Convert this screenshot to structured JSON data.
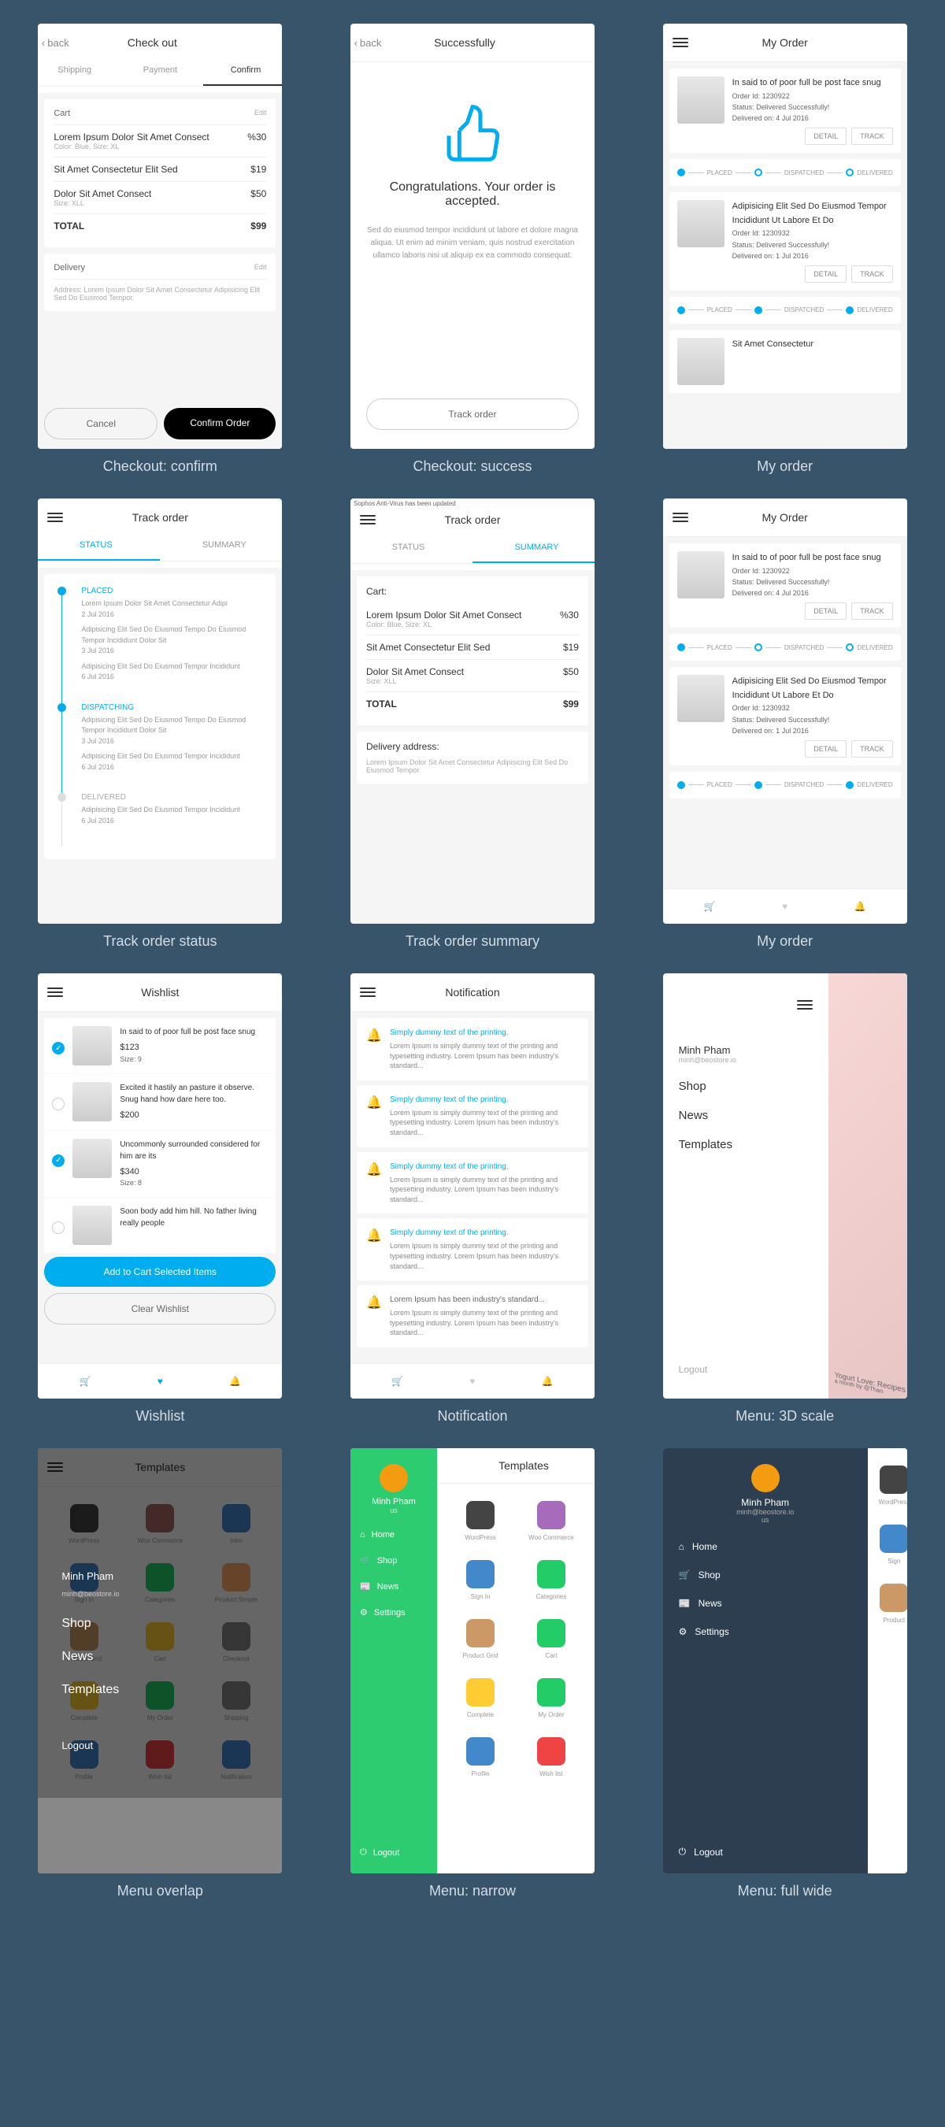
{
  "captions": {
    "checkout_confirm": "Checkout: confirm",
    "checkout_success": "Checkout: success",
    "my_order": "My order",
    "track_status": "Track order status",
    "track_summary": "Track order summary",
    "wishlist": "Wishlist",
    "notification": "Notification",
    "menu_3d": "Menu: 3D scale",
    "menu_overlap": "Menu overlap",
    "menu_narrow": "Menu: narrow",
    "menu_wide": "Menu: full wide"
  },
  "checkout": {
    "back": "back",
    "title": "Check out",
    "tabs": {
      "shipping": "Shipping",
      "payment": "Payment",
      "confirm": "Confirm"
    },
    "cart_label": "Cart",
    "edit": "Edit",
    "items": [
      {
        "name": "Lorem Ipsum Dolor Sit Amet Consect",
        "sub": "Color: Blue, Size: XL",
        "price": "%30"
      },
      {
        "name": "Sit Amet Consectetur Elit Sed",
        "sub": "",
        "price": "$19"
      },
      {
        "name": "Dolor Sit Amet Consect",
        "sub": "Size: XLL",
        "price": "$50"
      }
    ],
    "total_label": "TOTAL",
    "total_value": "$99",
    "delivery_label": "Delivery",
    "delivery_address": "Address: Lorem Ipsum Dolor Sit Amet Consectetur Adipisicing Elit Sed Do Eiusmod Tempor.",
    "cancel": "Cancel",
    "confirm_order": "Confirm Order"
  },
  "success": {
    "back": "back",
    "title": "Successfully",
    "headline": "Congratulations. Your order is accepted.",
    "body": "Sed do eiusmod tempor incididunt ut labore et dolore magna aliqua. Ut enim ad minim veniam, quis nostrud exercitation ullamco laboris nisi ut aliquip ex ea commodo consequat.",
    "track": "Track order"
  },
  "my_order": {
    "title": "My Order",
    "orders": [
      {
        "title": "In said to of poor full be post face snug",
        "id": "Order Id: 1230922",
        "status": "Status: Delivered Successfully!",
        "delivered": "Delivered on: 4 Jul 2016",
        "detail": "DETAIL",
        "track": "TRACK",
        "progress": {
          "placed": "PLACED",
          "dispatched": "DISPATCHED",
          "delivered": "DELIVERED"
        }
      },
      {
        "title": "Adipisicing Elit Sed Do Eiusmod Tempor Incididunt Ut Labore Et Do",
        "id": "Order Id: 1230932",
        "status": "Status: Delivered Successfully!",
        "delivered": "Delivered on: 1 Jul 2016",
        "detail": "DETAIL",
        "track": "TRACK"
      },
      {
        "title": "Sit Amet Consectetur"
      }
    ]
  },
  "track": {
    "title": "Track order",
    "tabs": {
      "status": "STATUS",
      "summary": "SUMMARY"
    },
    "system_msg": "Sophos Anti-Virus has been updated",
    "timeline": [
      {
        "title": "PLACED",
        "lines": [
          {
            "text": "Lorem Ipsum Dolor Sit Amet Consectetur Adipi",
            "date": "2 Jul 2016"
          },
          {
            "text": "Adipisicing Elit Sed Do Eiusmod Tempo Do Eiusmod Tempor Incididunt Dolor Sit",
            "date": "3 Jul 2016"
          },
          {
            "text": "Adipisicing Elit Sed Do Eiusmod Tempor Incididunt",
            "date": "6 Jul 2016"
          }
        ]
      },
      {
        "title": "DISPATCHING",
        "lines": [
          {
            "text": "Adipisicing Elit Sed Do Eiusmod Tempo Do Eiusmod Tempor Incididunt Dolor Sit",
            "date": "3 Jul 2016"
          },
          {
            "text": "Adipisicing Elit Sed Do Eiusmod Tempor Incididunt",
            "date": "6 Jul 2016"
          }
        ]
      },
      {
        "title": "DELIVERED",
        "lines": [
          {
            "text": "Adipisicing Elit Sed Do Eiusmod Tempor Incididunt",
            "date": "6 Jul 2016"
          }
        ]
      }
    ],
    "summary": {
      "cart": "Cart:",
      "delivery_label": "Delivery address:",
      "delivery_address": "Lorem Ipsum Dolor Sit Amet Consectetur Adipisicing Elit Sed Do Eiusmod Tempor."
    }
  },
  "wishlist": {
    "title": "Wishlist",
    "items": [
      {
        "title": "In said to of poor full be post face snug",
        "price": "$123",
        "size": "Size: 9",
        "checked": true
      },
      {
        "title": "Excited it hastily an pasture it observe. Snug hand how dare here too.",
        "price": "$200",
        "size": "",
        "checked": false
      },
      {
        "title": "Uncommonly surrounded considered for him are its",
        "price": "$340",
        "size": "Size: 8",
        "checked": true
      },
      {
        "title": "Soon body add him hill. No father living really people",
        "price": "",
        "size": "",
        "checked": false
      }
    ],
    "add_btn": "Add to Cart Selected Items",
    "clear_btn": "Clear Wishlist"
  },
  "notification": {
    "title": "Notification",
    "items": [
      {
        "title": "Simply dummy text of the printing.",
        "body": "Lorem Ipsum is simply dummy text of the printing and typesetting industry. Lorem Ipsum has been industry's standard...",
        "unread": true
      },
      {
        "title": "Simply dummy text of the printing.",
        "body": "Lorem Ipsum is simply dummy text of the printing and typesetting industry. Lorem Ipsum has been industry's standard...",
        "unread": true
      },
      {
        "title": "Simply dummy text of the printing.",
        "body": "Lorem Ipsum is simply dummy text of the printing and typesetting industry. Lorem Ipsum has been industry's standard...",
        "unread": true
      },
      {
        "title": "Simply dummy text of the printing.",
        "body": "Lorem Ipsum is simply dummy text of the printing and typesetting industry. Lorem Ipsum has been industry's standard...",
        "unread": true
      },
      {
        "title": "Lorem Ipsum has been industry's standard...",
        "body": "Lorem Ipsum is simply dummy text of the printing and typesetting industry. Lorem Ipsum has been industry's standard...",
        "unread": false
      }
    ]
  },
  "menu_3d": {
    "user": "Minh Pham",
    "email": "minh@beostore.io",
    "links": [
      "Shop",
      "News",
      "Templates"
    ],
    "logout": "Logout",
    "preview_title": "Yogurt Love: Recipes",
    "preview_sub": "a month by @Than"
  },
  "menu_overlap": {
    "header": "Templates",
    "user": "Minh Pham",
    "email": "minh@beostore.io",
    "links": [
      "Shop",
      "News",
      "Templates"
    ],
    "logout": "Logout",
    "grid": [
      "WordPress",
      "Woo Commerce",
      "Intro",
      "Sign In",
      "Categories",
      "Product Simple",
      "Product Grid",
      "Cart",
      "Checkout",
      "Complete",
      "My Order",
      "Shipping",
      "Profile",
      "Wish list",
      "Notification"
    ]
  },
  "menu_narrow": {
    "user": "Minh Pham",
    "country": "us",
    "links": [
      "Home",
      "Shop",
      "News",
      "Settings"
    ],
    "logout": "Logout",
    "header": "Templates",
    "grid": [
      "WordPress",
      "Woo Commerce",
      "Sign In",
      "Categories",
      "Product Grid",
      "Cart",
      "Complete",
      "My Order",
      "Profile",
      "Wish list"
    ]
  },
  "menu_wide": {
    "user": "Minh Pham",
    "email": "minh@beostore.io",
    "country": "us",
    "links": [
      "Home",
      "Shop",
      "News",
      "Settings"
    ],
    "logout": "Logout",
    "grid": [
      "WordPress",
      "Sign",
      "Product"
    ]
  }
}
